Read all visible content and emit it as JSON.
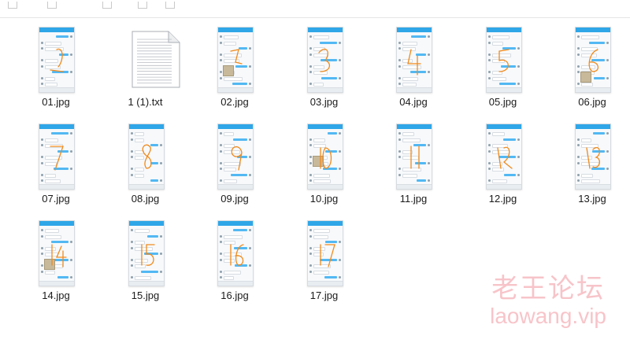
{
  "files": [
    {
      "name": "01.jpg",
      "kind": "image"
    },
    {
      "name": "1 (1).txt",
      "kind": "text"
    },
    {
      "name": "02.jpg",
      "kind": "image"
    },
    {
      "name": "03.jpg",
      "kind": "image"
    },
    {
      "name": "04.jpg",
      "kind": "image"
    },
    {
      "name": "05.jpg",
      "kind": "image"
    },
    {
      "name": "06.jpg",
      "kind": "image"
    },
    {
      "name": "07.jpg",
      "kind": "image"
    },
    {
      "name": "08.jpg",
      "kind": "image"
    },
    {
      "name": "09.jpg",
      "kind": "image"
    },
    {
      "name": "10.jpg",
      "kind": "image"
    },
    {
      "name": "11.jpg",
      "kind": "image"
    },
    {
      "name": "12.jpg",
      "kind": "image"
    },
    {
      "name": "13.jpg",
      "kind": "image"
    },
    {
      "name": "14.jpg",
      "kind": "image"
    },
    {
      "name": "15.jpg",
      "kind": "image"
    },
    {
      "name": "16.jpg",
      "kind": "image"
    },
    {
      "name": "17.jpg",
      "kind": "image"
    }
  ],
  "watermark": {
    "chinese": "老王论坛",
    "url": "laowang.vip"
  },
  "colors": {
    "chat_header": "#2fa6e8",
    "scrawl": "#f08a1c",
    "watermark": "#f4a5ad"
  }
}
